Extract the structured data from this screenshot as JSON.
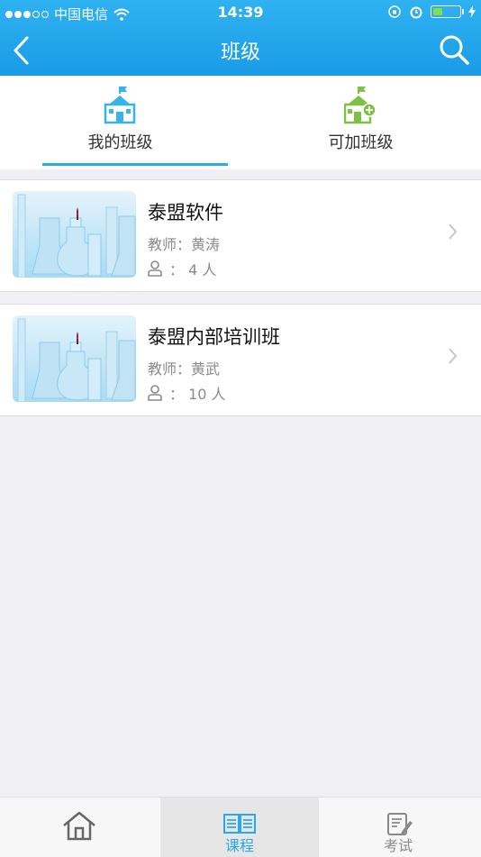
{
  "status_bar": {
    "carrier": "中国电信",
    "time": "14:39",
    "battery_level": 0.35
  },
  "nav": {
    "title": "班级",
    "back_icon": "chevron-left-icon",
    "search_icon": "search-icon"
  },
  "tabs": [
    {
      "label": "我的班级",
      "icon": "school-icon",
      "active": true,
      "color": "#39b4e8"
    },
    {
      "label": "可加班级",
      "icon": "school-add-icon",
      "active": false,
      "color": "#7dc243"
    }
  ],
  "classes": [
    {
      "name": "泰盟软件",
      "teacher": "教师：黄涛",
      "member_count": "：  4 人"
    },
    {
      "name": "泰盟内部培训班",
      "teacher": "教师：黄武",
      "member_count": "：  10 人"
    }
  ],
  "tabbar": [
    {
      "label": "",
      "icon": "home-icon",
      "active": false
    },
    {
      "label": "课程",
      "icon": "book-icon",
      "active": true
    },
    {
      "label": "考试",
      "icon": "exam-edit-icon",
      "active": false
    }
  ],
  "colors": {
    "accent": "#2aa8ea",
    "header": "#1a9be6",
    "green": "#7dc243"
  }
}
